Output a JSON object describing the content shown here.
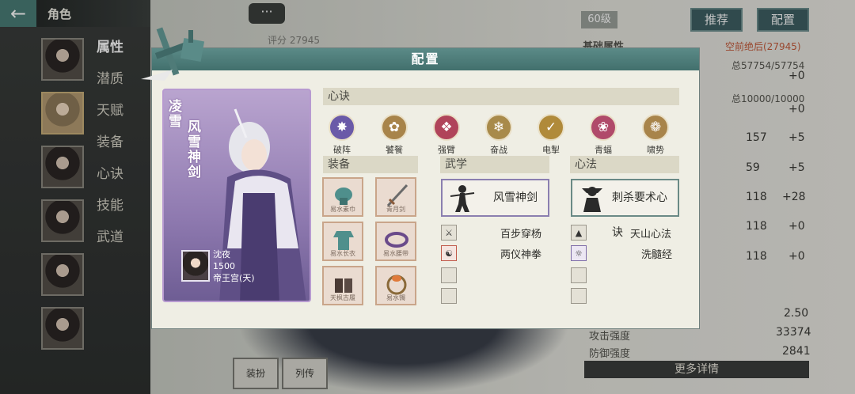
{
  "nav": {
    "title": "角色",
    "menu": [
      "属性",
      "潜质",
      "天赋",
      "装备",
      "心诀",
      "技能",
      "武道"
    ]
  },
  "background": {
    "chat_bubble": "···",
    "level": "60级",
    "recommend_button": "推荐",
    "config_button": "配置",
    "score": "评分 27945",
    "base_attr_label": "基础属性",
    "rank": "空前绝后(27945)",
    "hp": "总57754/57754",
    "hp_plus": "+0",
    "mp": "总10000/10000",
    "mp_plus": "+0",
    "stats": [
      {
        "value": "157",
        "plus": "+5"
      },
      {
        "value": "59",
        "plus": "+5"
      },
      {
        "value": "118",
        "plus": "+28"
      },
      {
        "value": "118",
        "plus": "+0"
      },
      {
        "value": "118",
        "plus": "+0"
      }
    ],
    "row_value": "2.50",
    "attack_label": "攻击强度",
    "attack_value": "33374",
    "defense_label": "防御强度",
    "defense_value": "2841",
    "more_details": "更多详情",
    "bottom_tab_1": "装扮",
    "bottom_tab_2": "列传"
  },
  "modal": {
    "title": "配置",
    "card": {
      "name_part_1": "凌雪",
      "name_part_2": "风雪神剑",
      "companion_name": "沈夜",
      "companion_power": "1500",
      "companion_sect": "帝王宫(天)"
    },
    "xinjue": {
      "header": "心诀",
      "items": [
        {
          "label": "破阵",
          "color": "#6a5aa8",
          "icon": "vortex-icon"
        },
        {
          "label": "饕餮",
          "color": "#a8844a",
          "icon": "beast-icon"
        },
        {
          "label": "强臂",
          "color": "#b0445a",
          "icon": "fist-icon"
        },
        {
          "label": "奋战",
          "color": "#a88a4a",
          "icon": "flame-icon"
        },
        {
          "label": "电掣",
          "color": "#b08a3a",
          "icon": "lightning-icon"
        },
        {
          "label": "青蝠",
          "color": "#b04a6a",
          "icon": "bat-icon"
        },
        {
          "label": "啸势",
          "color": "#a8844a",
          "icon": "roar-icon"
        }
      ]
    },
    "equipment": {
      "header": "装备",
      "slots": [
        "易水素巾",
        "青月剑",
        "易水长衣",
        "易水腰带",
        "天枫古履",
        "易水镯"
      ]
    },
    "wuxue": {
      "header": "武学",
      "main": "风雪神剑",
      "subs": [
        "百步穿杨",
        "两仪神拳"
      ]
    },
    "xinfa": {
      "header": "心法",
      "main": "刺杀要术心诀",
      "subs": [
        "天山心法",
        "洗髓经"
      ]
    }
  }
}
